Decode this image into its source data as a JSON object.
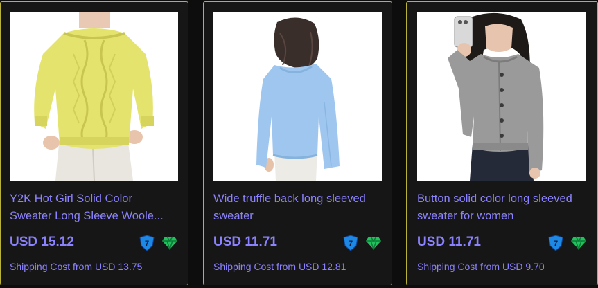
{
  "products": [
    {
      "title_line1": "Y2K Hot Girl Solid Color",
      "title_line2": "Sweater Long Sleeve Woole...",
      "price": "USD 15.12",
      "shipping": "Shipping Cost from USD 13.75",
      "badge_number": "7",
      "image_icon": "yellow-sweater-photo"
    },
    {
      "title_line1": "Wide truffle back long sleeved",
      "title_line2": "sweater",
      "price": "USD 11.71",
      "shipping": "Shipping Cost from USD 12.81",
      "badge_number": "7",
      "image_icon": "blue-sweater-photo"
    },
    {
      "title_line1": "Button solid color long sleeved",
      "title_line2": "sweater for women",
      "price": "USD 11.71",
      "shipping": "Shipping Cost from USD 9.70",
      "badge_number": "7",
      "image_icon": "gray-cardigan-photo"
    }
  ],
  "colors": {
    "background": "#0d0d0d",
    "card": "#161616",
    "border": "#b8b13a",
    "link_text": "#8b82ff",
    "shield": "#1e88e5",
    "diamond": "#21c25e"
  }
}
